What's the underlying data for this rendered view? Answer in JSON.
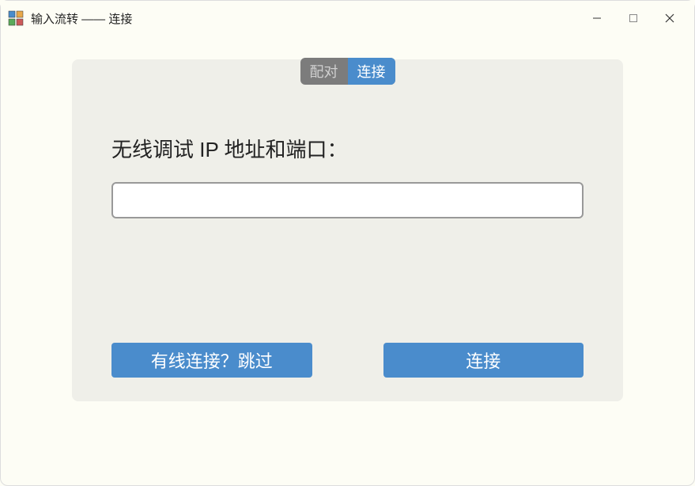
{
  "window": {
    "title": "输入流转 —— 连接"
  },
  "tabs": {
    "pair": "配对",
    "connect": "连接"
  },
  "form": {
    "label": "无线调试 IP 地址和端口：",
    "input_value": ""
  },
  "buttons": {
    "skip": "有线连接？跳过",
    "connect": "连接"
  }
}
